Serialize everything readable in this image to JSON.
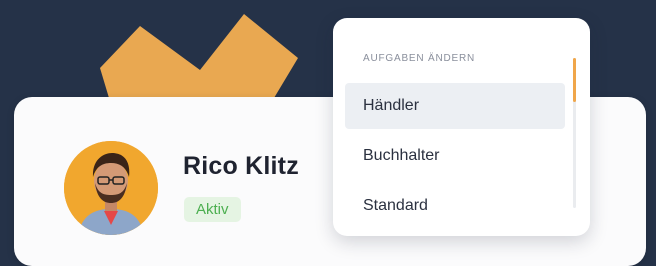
{
  "user": {
    "name": "Rico Klitz",
    "status": "Aktiv"
  },
  "menu": {
    "heading": "AUFGABEN ÄNDERN",
    "items": [
      {
        "label": "Händler",
        "selected": true
      },
      {
        "label": "Buchhalter",
        "selected": false
      },
      {
        "label": "Standard",
        "selected": false
      }
    ]
  },
  "colors": {
    "background": "#253248",
    "accent_shape": "#e9a851",
    "status_text": "#4caf50",
    "status_bg": "#e5f4e3",
    "scroll_thumb": "#f0a64a"
  }
}
